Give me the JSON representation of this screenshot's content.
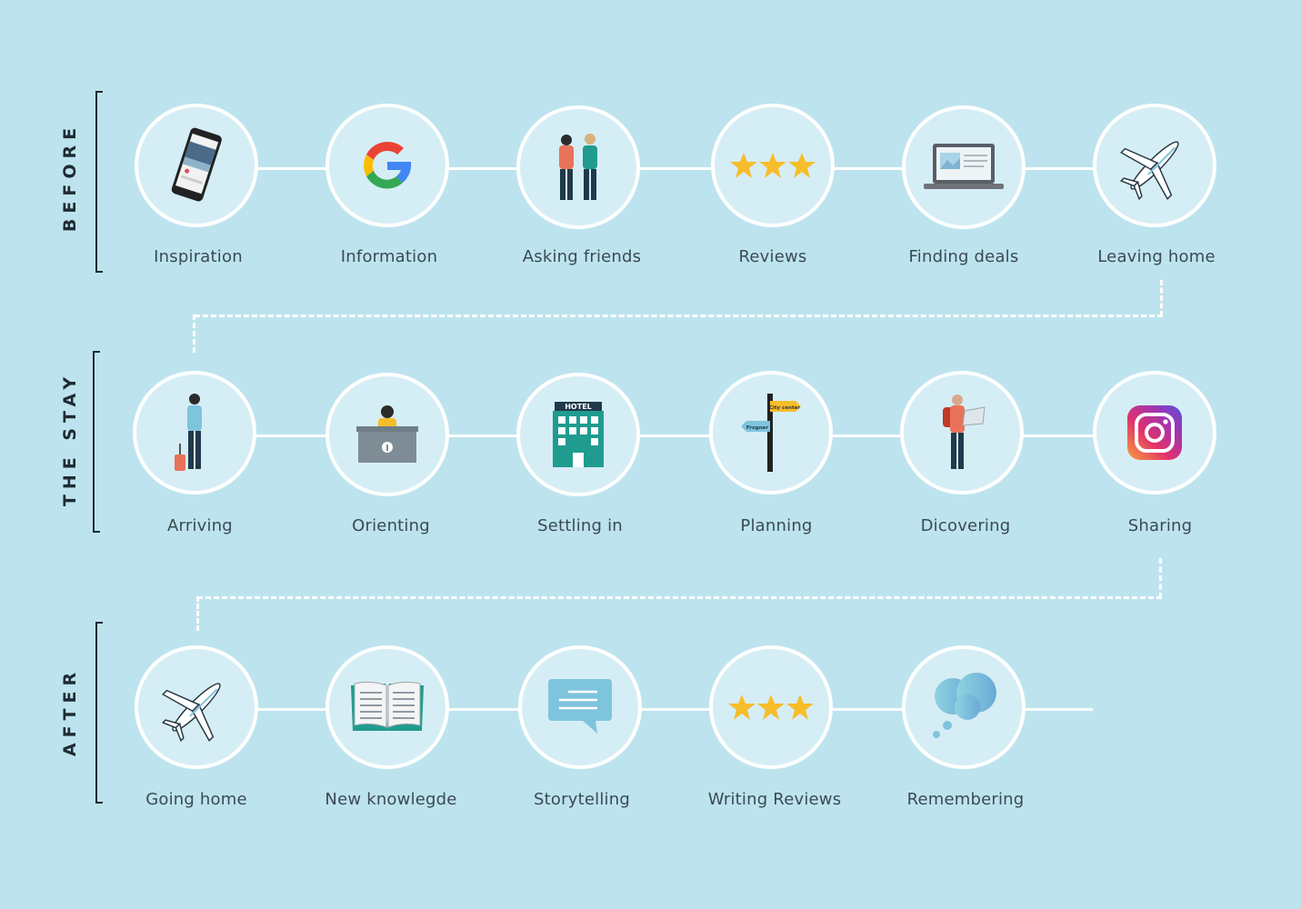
{
  "phases": {
    "before": "BEFORE",
    "stay": "THE STAY",
    "after": "AFTER"
  },
  "steps": {
    "before": [
      "Inspiration",
      "Information",
      "Asking friends",
      "Reviews",
      "Finding deals",
      "Leaving home"
    ],
    "stay": [
      "Arriving",
      "Orienting",
      "Settling in",
      "Planning",
      "Dicovering",
      "Sharing"
    ],
    "after": [
      "Going home",
      "New knowlegde",
      "Storytelling",
      "Writing Reviews",
      "Remembering"
    ]
  },
  "icons": {
    "before": [
      "phone-icon",
      "google-icon",
      "friends-icon",
      "stars-icon",
      "laptop-icon",
      "airplane-icon"
    ],
    "stay": [
      "traveler-icon",
      "reception-desk-icon",
      "hotel-icon",
      "signpost-icon",
      "explorer-icon",
      "instagram-icon"
    ],
    "after": [
      "airplane-icon",
      "book-icon",
      "chat-bubble-icon",
      "stars-icon",
      "thought-cloud-icon"
    ]
  },
  "icon_text": {
    "hotel_sign": "HOTEL",
    "sign_city": "City center",
    "sign_frogner": "Frogner"
  },
  "colors": {
    "background": "#bde4ee",
    "circle_fill": "#d5eef5",
    "connector": "#ffffff",
    "text": "#3b4a54",
    "phase_text": "#1f2b33",
    "star": "#f7bd2a"
  }
}
